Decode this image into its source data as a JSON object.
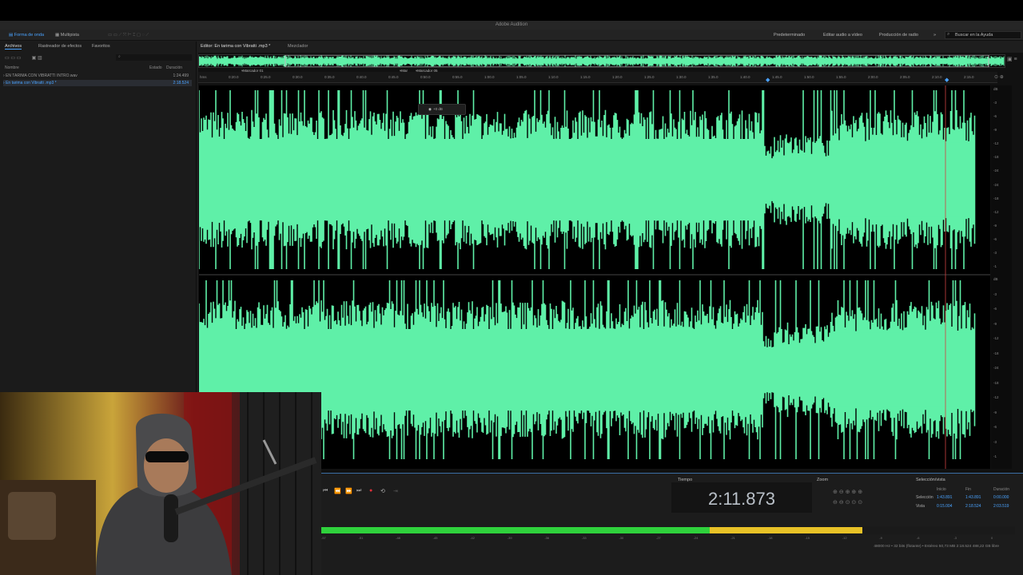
{
  "app": {
    "title": "Adobe Audition"
  },
  "toolbar": {
    "waveform_tab": "Forma de onda",
    "multitrack_tab": "Multipista",
    "workspaces": [
      "Predeterminado",
      "Editar audio a vídeo",
      "Producción de radio"
    ],
    "help_placeholder": "Buscar en la Ayuda"
  },
  "files_panel": {
    "tabs": [
      "Archivos",
      "Rastreador de efectos",
      "Favoritos"
    ],
    "col_name": "Nombre",
    "col_status": "Estado",
    "col_duration": "Duración",
    "rows": [
      {
        "name": "EN TARIMA CON VIBRATTI INTRO.wav",
        "duration": "1:24.499"
      },
      {
        "name": "En tarima con Vibratti .mp3 *",
        "duration": "2:18.524"
      }
    ]
  },
  "editor": {
    "tab_editor": "Editor: En tarima con Vibratti .mp3 *",
    "tab_mixer": "Mezclador",
    "ruler_units": "hms",
    "ticks": [
      "0:20.0",
      "0:25.0",
      "0:30.0",
      "0:35.0",
      "0:40.0",
      "0:45.0",
      "0:50.0",
      "0:55.0",
      "1:00.0",
      "1:05.0",
      "1:10.0",
      "1:15.0",
      "1:20.0",
      "1:25.0",
      "1:30.0",
      "1:35.0",
      "1:40.0",
      "1:45.0",
      "1:50.0",
      "1:55.0",
      "2:00.0",
      "2:05.0",
      "2:10.0",
      "2:15.0"
    ],
    "markers": [
      "Marcador 01",
      "Mar",
      "Marcador 05"
    ],
    "hud_gain": "+0 dB",
    "db_top": [
      "dB",
      "-3",
      "-6",
      "-9",
      "-12",
      "-18",
      "-24",
      "-24",
      "-18",
      "-12",
      "-9",
      "-6",
      "-3",
      "-1"
    ],
    "db_bottom": [
      "dB",
      "-3",
      "-6",
      "-9",
      "-12",
      "-18",
      "-24",
      "-18",
      "-12",
      "-9",
      "-6",
      "-3",
      "-1"
    ],
    "wave_color": "#5ff0a8"
  },
  "time_panel": {
    "title": "Tiempo",
    "value": "2:11.873"
  },
  "zoom_panel": {
    "title": "Zoom"
  },
  "selection_panel": {
    "title": "Selección/vista",
    "col_start": "Inicio",
    "col_end": "Fin",
    "col_duration": "Duración",
    "rows": [
      {
        "label": "Selección",
        "start": "1:43.891",
        "end": "1:43.891",
        "duration": "0:00.000"
      },
      {
        "label": "Vista",
        "start": "0:15.004",
        "end": "2:18.524",
        "duration": "2:03.519"
      }
    ]
  },
  "meter": {
    "level_green": 0.56,
    "level_yellow": 0.78,
    "labels": [
      "-57",
      "-51",
      "-48",
      "-45",
      "-42",
      "-39",
      "-36",
      "-33",
      "-30",
      "-27",
      "-24",
      "-21",
      "-18",
      "-15",
      "-12",
      "-9",
      "-6",
      "-3",
      "0"
    ]
  },
  "status_bar": {
    "text": "48000 Hz • 32 bits (flotante) • Estéreo    50,73 MB    2:18.524    488,22 GB libre"
  }
}
